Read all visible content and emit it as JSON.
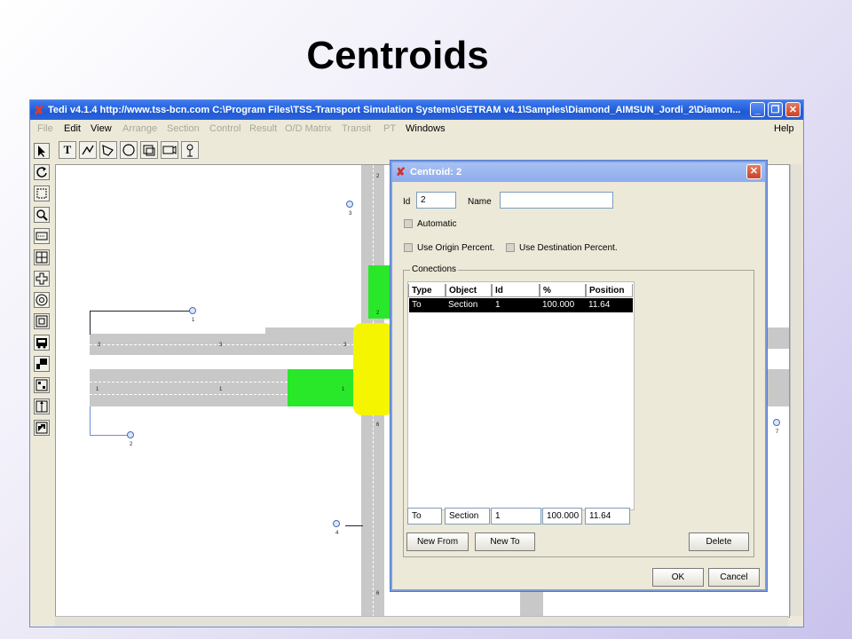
{
  "slide_title": "Centroids",
  "window": {
    "title": "Tedi v4.1.4 http://www.tss-bcn.com C:\\Program Files\\TSS-Transport Simulation Systems\\GETRAM v4.1\\Samples\\Diamond_AIMSUN_Jordi_2\\Diamon...",
    "minimize_label": "_",
    "maximize_label": "❐",
    "close_label": "✕"
  },
  "menu": {
    "items": [
      "File",
      "Edit",
      "View",
      "Arrange",
      "Section",
      "Control",
      "Result",
      "O/D Matrix",
      "Transit",
      "PT",
      "Windows"
    ],
    "help": "Help"
  },
  "toolbar": {
    "text_tool": "T"
  },
  "canvas_labels": {
    "centroid_1": "1",
    "centroid_2": "2",
    "centroid_3": "3",
    "centroid_4": "4",
    "centroid_7": "7",
    "sec3_a": "3",
    "sec3_b": "3",
    "sec3_c": "3",
    "sec1_a": "1",
    "sec1_b": "1",
    "sec1_c": "1",
    "sec2": "2",
    "sec6": "6",
    "sec6b": "6",
    "sec2b": "2"
  },
  "dialog": {
    "title": "Centroid: 2",
    "close_label": "✕",
    "id_label": "Id",
    "id_value": "2",
    "name_label": "Name",
    "name_value": "",
    "automatic_label": "Automatic",
    "use_origin_label": "Use Origin Percent.",
    "use_destination_label": "Use Destination Percent.",
    "connections_label": "Conections",
    "columns": [
      "Type",
      "Object",
      "Id",
      "%",
      "Position"
    ],
    "rows": [
      {
        "type": "To",
        "object": "Section",
        "id": "1",
        "percent": "100.000",
        "position": "11.64"
      }
    ],
    "edit": {
      "type": "To",
      "object": "Section",
      "id": "1",
      "percent": "100.000",
      "position": "11.64"
    },
    "buttons": {
      "new_from": "New From",
      "new_to": "New To",
      "delete": "Delete",
      "ok": "OK",
      "cancel": "Cancel"
    }
  }
}
